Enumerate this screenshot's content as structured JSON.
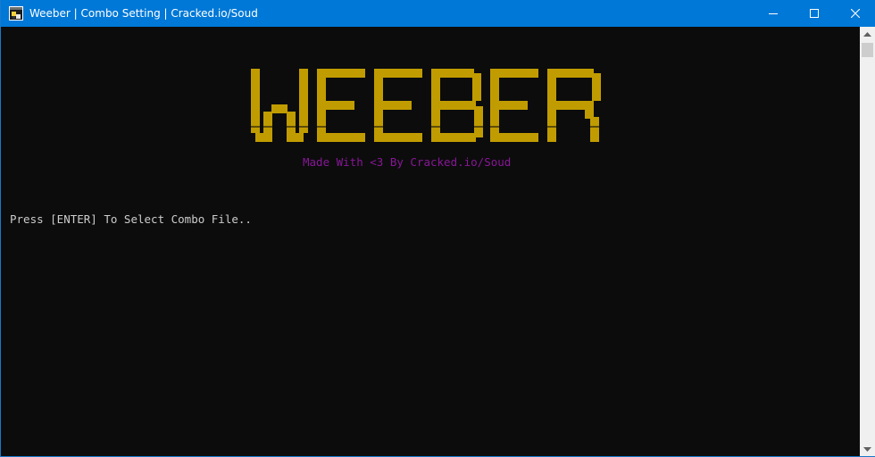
{
  "window": {
    "title": "Weeber | Combo Setting | Cracked.io/Soud",
    "icon": "console-app-icon",
    "controls": [
      "minimize-icon",
      "maximize-icon",
      "close-icon"
    ]
  },
  "console": {
    "logo_text": "WEEBER",
    "subtitle": "Made With <3 By Cracked.io/Soud",
    "prompt": "Press [ENTER] To Select Combo File.."
  },
  "colors": {
    "titlebar": "#0078d7",
    "console_bg": "#0c0c0c",
    "logo": "#c19c00",
    "subtitle": "#881798",
    "prompt": "#cccccc"
  }
}
